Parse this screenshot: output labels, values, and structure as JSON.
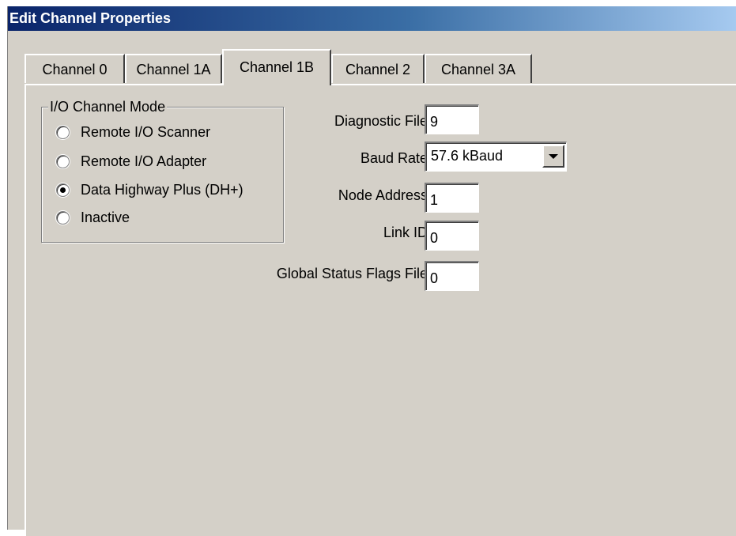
{
  "window": {
    "title": "Edit Channel Properties"
  },
  "tabs": [
    {
      "label": "Channel 0",
      "active": false
    },
    {
      "label": "Channel 1A",
      "active": false
    },
    {
      "label": "Channel 1B",
      "active": true
    },
    {
      "label": "Channel 2",
      "active": false
    },
    {
      "label": "Channel 3A",
      "active": false
    }
  ],
  "mode_group": {
    "title": "I/O Channel Mode",
    "options": [
      {
        "label": "Remote I/O Scanner",
        "checked": false
      },
      {
        "label": "Remote I/O Adapter",
        "checked": false
      },
      {
        "label": "Data Highway Plus (DH+)",
        "checked": true
      },
      {
        "label": "Inactive",
        "checked": false
      }
    ]
  },
  "fields": {
    "diagnostic_file": {
      "label": "Diagnostic File:",
      "value": "9"
    },
    "baud_rate": {
      "label": "Baud Rate:",
      "value": "57.6 kBaud"
    },
    "node_address": {
      "label": "Node Address:",
      "value": "1"
    },
    "link_id": {
      "label": "Link ID:",
      "value": "0"
    },
    "global_status": {
      "label": "Global Status Flags File:",
      "value": "0"
    }
  }
}
